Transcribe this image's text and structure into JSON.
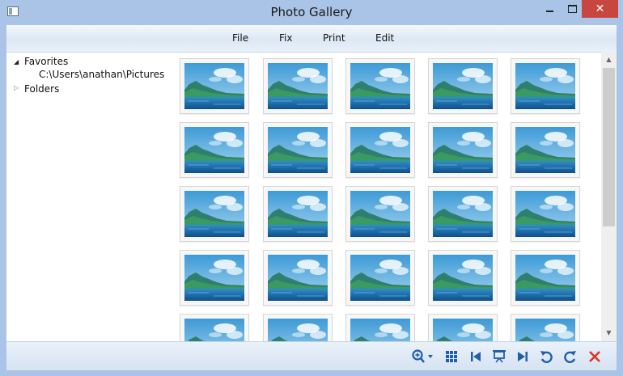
{
  "window": {
    "title": "Photo Gallery",
    "close_glyph": "✕"
  },
  "menu": {
    "items": [
      "File",
      "Fix",
      "Print",
      "Edit"
    ]
  },
  "tree": {
    "favorites_label": "Favorites",
    "favorites_path": "C:\\Users\\anathan\\Pictures",
    "folders_label": "Folders",
    "expanded_glyph": "◢",
    "collapsed_glyph": "▷"
  },
  "gallery": {
    "thumbnail_icon": "landscape-photo-icon",
    "visible_rows": 5,
    "columns": 5
  },
  "scrollbar": {
    "up_glyph": "▲",
    "down_glyph": "▼"
  },
  "toolbar": {
    "icons": [
      "zoom-icon",
      "grid-view-icon",
      "previous-icon",
      "slideshow-icon",
      "next-icon",
      "rotate-left-icon",
      "rotate-right-icon",
      "delete-icon"
    ]
  },
  "colors": {
    "frame": "#a9c4e6",
    "close_button": "#c7463f",
    "toolbar_icon": "#1f5ea8",
    "delete_icon": "#d9362c"
  }
}
